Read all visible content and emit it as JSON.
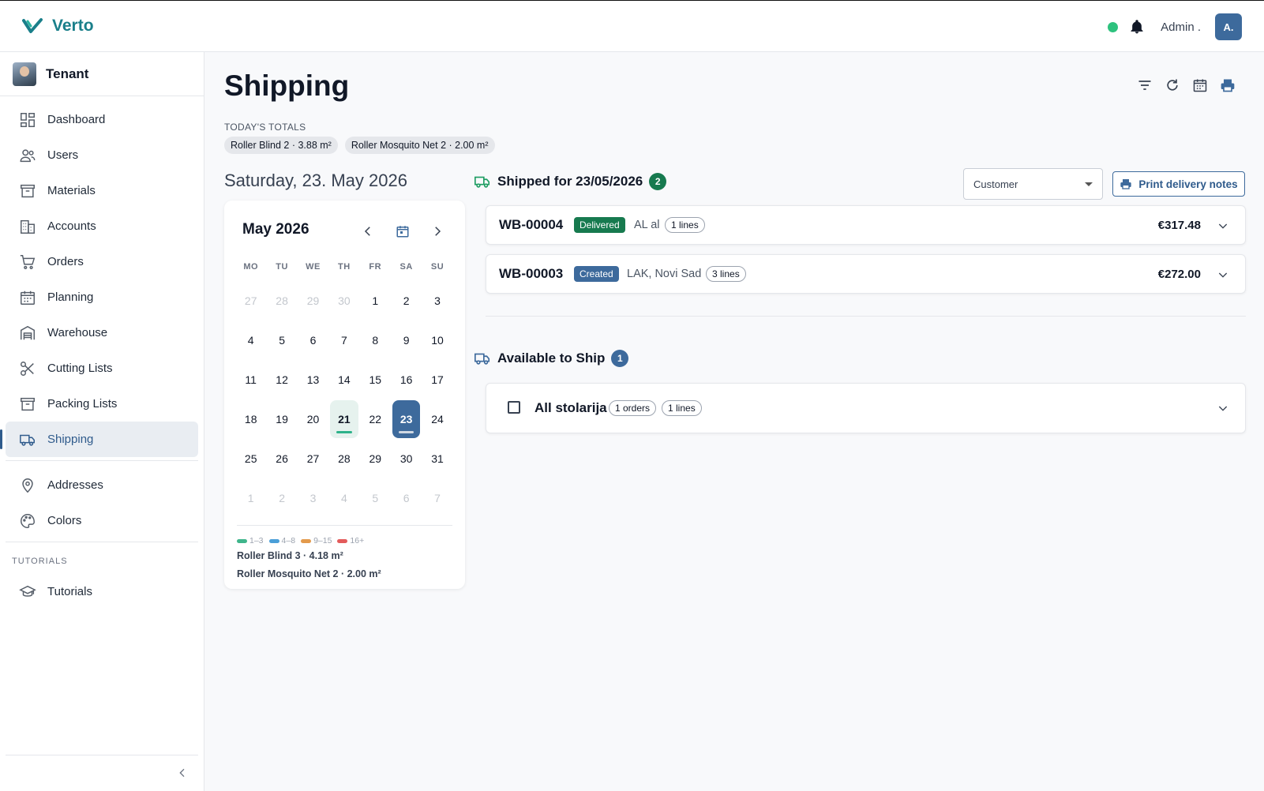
{
  "app": {
    "name": "Verto"
  },
  "header": {
    "user_name": "Admin .",
    "user_initials": "A."
  },
  "tenant": {
    "name": "Tenant"
  },
  "nav": {
    "items": [
      {
        "label": "Dashboard"
      },
      {
        "label": "Users"
      },
      {
        "label": "Materials"
      },
      {
        "label": "Accounts"
      },
      {
        "label": "Orders"
      },
      {
        "label": "Planning"
      },
      {
        "label": "Warehouse"
      },
      {
        "label": "Cutting Lists"
      },
      {
        "label": "Packing Lists"
      },
      {
        "label": "Shipping"
      }
    ],
    "secondary": [
      {
        "label": "Addresses"
      },
      {
        "label": "Colors"
      }
    ],
    "section_label": "TUTORIALS",
    "tutorials": [
      {
        "label": "Tutorials"
      }
    ]
  },
  "page": {
    "title": "Shipping",
    "totals_label": "TODAY'S TOTALS",
    "totals": [
      "Roller Blind 2 · 3.88 m²",
      "Roller Mosquito Net 2 · 2.00 m²"
    ],
    "date_heading": "Saturday, 23. May 2026"
  },
  "calendar": {
    "month_label": "May 2026",
    "weekdays": [
      "MO",
      "TU",
      "WE",
      "TH",
      "FR",
      "SA",
      "SU"
    ],
    "weeks": [
      [
        27,
        28,
        29,
        30,
        1,
        2,
        3
      ],
      [
        4,
        5,
        6,
        7,
        8,
        9,
        10
      ],
      [
        11,
        12,
        13,
        14,
        15,
        16,
        17
      ],
      [
        18,
        19,
        20,
        21,
        22,
        23,
        24
      ],
      [
        25,
        26,
        27,
        28,
        29,
        30,
        31
      ],
      [
        1,
        2,
        3,
        4,
        5,
        6,
        7
      ]
    ],
    "today": 21,
    "selected": 23,
    "legend": [
      {
        "label": "1–3",
        "color": "#3fb58b"
      },
      {
        "label": "4–8",
        "color": "#4a9fd8"
      },
      {
        "label": "9–15",
        "color": "#e39a4c"
      },
      {
        "label": "16+",
        "color": "#e35b5b"
      }
    ],
    "summary": [
      "Roller Blind 3 · 4.18 m²",
      "Roller Mosquito Net 2 · 2.00 m²"
    ]
  },
  "shipped": {
    "title": "Shipped for 23/05/2026",
    "count": "2",
    "customer_placeholder": "Customer",
    "print_label": "Print delivery notes",
    "orders": [
      {
        "id": "WB-00004",
        "status": "Delivered",
        "customer": "AL al",
        "lines": "1 lines",
        "price": "€317.48"
      },
      {
        "id": "WB-00003",
        "status": "Created",
        "customer": "LAK, Novi Sad",
        "lines": "3 lines",
        "price": "€272.00"
      }
    ]
  },
  "available": {
    "title": "Available to Ship",
    "count": "1",
    "groups": [
      {
        "name": "All stolarija",
        "orders": "1 orders",
        "lines": "1 lines"
      }
    ]
  },
  "colors": {
    "accent": "#3d6a9c",
    "delivered": "#177a4f",
    "created": "#3d6a9c",
    "brand": "#1a7f8a"
  }
}
